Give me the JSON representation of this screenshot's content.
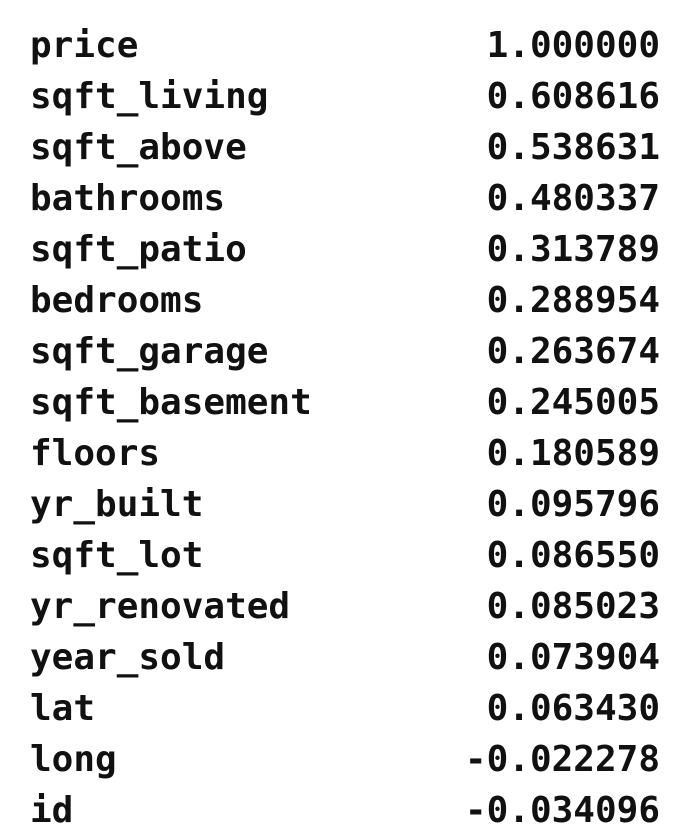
{
  "rows": [
    {
      "name": "price",
      "value": "1.000000"
    },
    {
      "name": "sqft_living",
      "value": "0.608616"
    },
    {
      "name": "sqft_above",
      "value": "0.538631"
    },
    {
      "name": "bathrooms",
      "value": "0.480337"
    },
    {
      "name": "sqft_patio",
      "value": "0.313789"
    },
    {
      "name": "bedrooms",
      "value": "0.288954"
    },
    {
      "name": "sqft_garage",
      "value": "0.263674"
    },
    {
      "name": "sqft_basement",
      "value": "0.245005"
    },
    {
      "name": "floors",
      "value": "0.180589"
    },
    {
      "name": "yr_built",
      "value": "0.095796"
    },
    {
      "name": "sqft_lot",
      "value": "0.086550"
    },
    {
      "name": "yr_renovated",
      "value": "0.085023"
    },
    {
      "name": "year_sold",
      "value": "0.073904"
    },
    {
      "name": "lat",
      "value": "0.063430"
    },
    {
      "name": "long",
      "value": "-0.022278"
    },
    {
      "name": "id",
      "value": "-0.034096"
    }
  ]
}
